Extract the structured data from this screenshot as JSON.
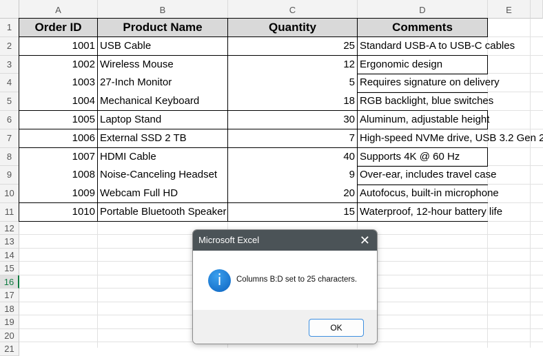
{
  "columns": [
    "A",
    "B",
    "C",
    "D",
    "E"
  ],
  "row_numbers": [
    "1",
    "2",
    "3",
    "4",
    "5",
    "6",
    "7",
    "8",
    "9",
    "10",
    "11",
    "12",
    "13",
    "14",
    "15",
    "16",
    "17",
    "18",
    "19",
    "20",
    "21"
  ],
  "headers": [
    "Order ID",
    "Product Name",
    "Quantity",
    "Comments"
  ],
  "rows": [
    [
      "1001",
      "USB Cable",
      "25",
      "Standard USB-A to USB-C cables"
    ],
    [
      "1002",
      "Wireless Mouse",
      "12",
      "Ergonomic design"
    ],
    [
      "1003",
      "27-Inch Monitor",
      "5",
      "Requires signature on delivery"
    ],
    [
      "1004",
      "Mechanical Keyboard",
      "18",
      "RGB backlight, blue switches"
    ],
    [
      "1005",
      "Laptop Stand",
      "30",
      "Aluminum, adjustable height"
    ],
    [
      "1006",
      "External SSD 2 TB",
      "7",
      "High-speed NVMe drive, USB 3.2 Gen 2"
    ],
    [
      "1007",
      "HDMI Cable",
      "40",
      "Supports 4K @ 60 Hz"
    ],
    [
      "1008",
      "Noise-Canceling Headset",
      "9",
      "Over-ear, includes travel case"
    ],
    [
      "1009",
      "Webcam Full HD",
      "20",
      "Autofocus, built-in microphone"
    ],
    [
      "1010",
      "Portable Bluetooth Speaker",
      "15",
      "Waterproof, 12-hour battery life"
    ]
  ],
  "dialog": {
    "title": "Microsoft Excel",
    "message": "Columns B:D set to 25 characters.",
    "ok_label": "OK",
    "close_glyph": "✕",
    "info_glyph": "i"
  }
}
